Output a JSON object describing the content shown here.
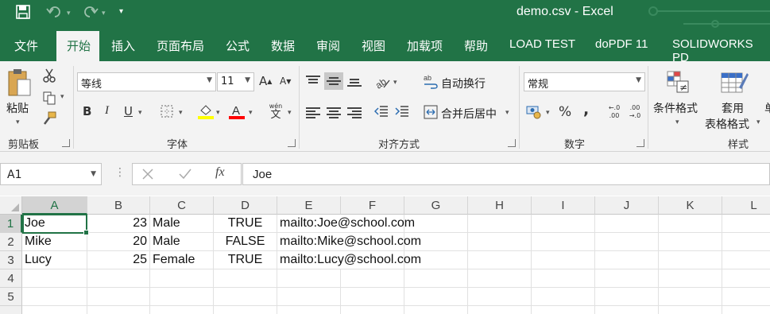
{
  "title": "demo.csv  -  Excel",
  "qat": {
    "save_icon": "save-icon",
    "undo_icon": "undo-icon",
    "redo_icon": "redo-icon",
    "customize_icon": "customize-icon"
  },
  "tabs": [
    "文件",
    "开始",
    "插入",
    "页面布局",
    "公式",
    "数据",
    "审阅",
    "视图",
    "加载项",
    "帮助",
    "LOAD TEST",
    "doPDF 11",
    "SOLIDWORKS PD"
  ],
  "ribbon": {
    "clipboard": {
      "paste": "粘贴",
      "label": "剪贴板"
    },
    "font": {
      "name": "等线",
      "size": "11",
      "label": "字体",
      "bold": "B",
      "italic": "I",
      "underline": "U",
      "grow": "A",
      "shrink": "A",
      "phonetic": "wén",
      "phonetic_char": "文"
    },
    "alignment": {
      "wrap": "自动换行",
      "merge": "合并后居中",
      "label": "对齐方式"
    },
    "number": {
      "format": "常规",
      "percent": "%",
      "comma": ",",
      "label": "数字",
      "inc_top": "←.0",
      "inc_bot": ".00",
      "dec_top": ".00",
      "dec_bot": "→.0"
    },
    "styles": {
      "conditional": "条件格式",
      "table_top": "套用",
      "table_bottom": "表格格式",
      "label": "样式",
      "cell_styles_partial": "单"
    }
  },
  "colors": {
    "accent": "#217346",
    "fill_color": "#ffff00",
    "font_color": "#ff0000"
  },
  "namebox": "A1",
  "formula": {
    "fx": "fx",
    "value": "Joe"
  },
  "columns": [
    "A",
    "B",
    "C",
    "D",
    "E",
    "F",
    "G",
    "H",
    "I",
    "J",
    "K",
    "L"
  ],
  "rows": [
    "1",
    "2",
    "3",
    "4",
    "5"
  ],
  "data": [
    {
      "a": "Joe",
      "b": "23",
      "c": "Male",
      "d": "TRUE",
      "e": "mailto:Joe@school.com"
    },
    {
      "a": "Mike",
      "b": "20",
      "c": "Male",
      "d": "FALSE",
      "e": "mailto:Mike@school.com"
    },
    {
      "a": "Lucy",
      "b": "25",
      "c": "Female",
      "d": "TRUE",
      "e": "mailto:Lucy@school.com"
    }
  ]
}
